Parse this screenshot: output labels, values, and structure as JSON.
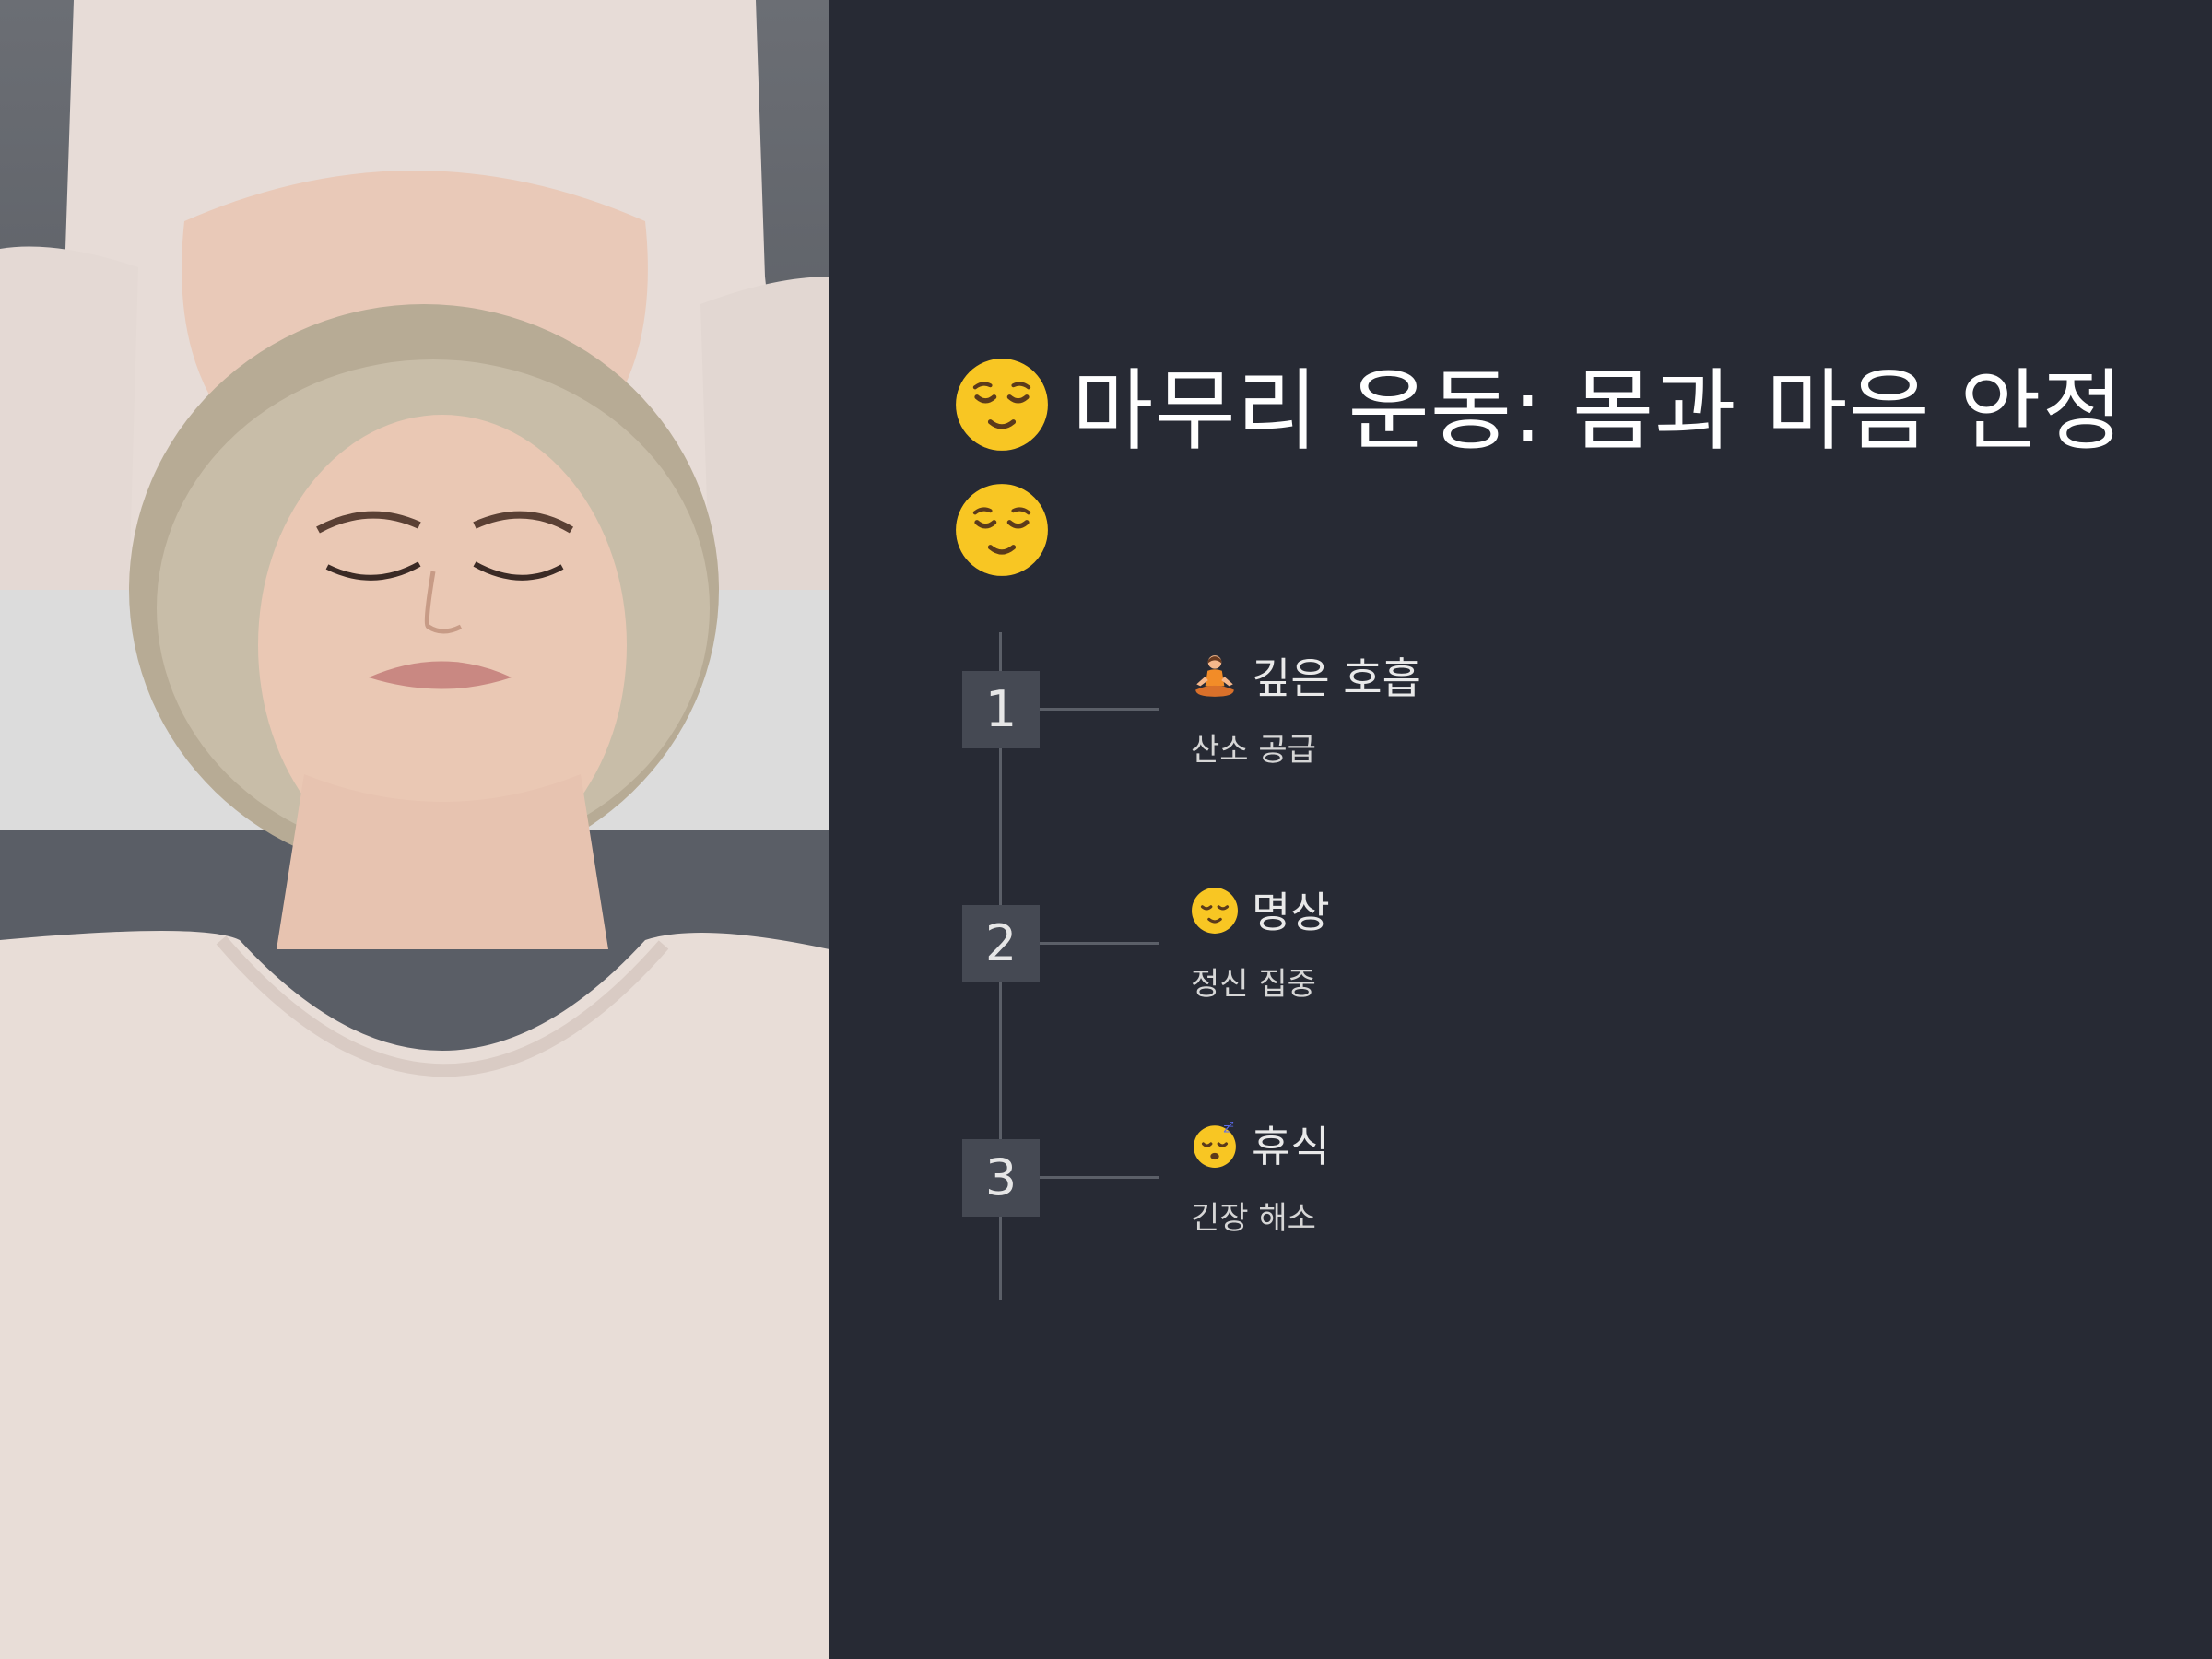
{
  "title": {
    "text": "마무리 운동: 몸과 마음 안정",
    "leading_icon": "relieved-face-emoji",
    "trailing_icon": "relieved-face-emoji"
  },
  "photo": {
    "subject": "woman-lying-relaxed-photo"
  },
  "steps": [
    {
      "number": "1",
      "icon": "person-in-lotus-position-emoji",
      "title": "깊은 호흡",
      "description": "산소 공급"
    },
    {
      "number": "2",
      "icon": "relieved-face-emoji",
      "title": "명상",
      "description": "정신 집중"
    },
    {
      "number": "3",
      "icon": "sleeping-face-emoji",
      "title": "휴식",
      "description": "긴장 해소"
    }
  ],
  "colors": {
    "background": "#272a34",
    "step_box": "#454953",
    "timeline": "#5b5f68",
    "text": "#ffffff"
  }
}
